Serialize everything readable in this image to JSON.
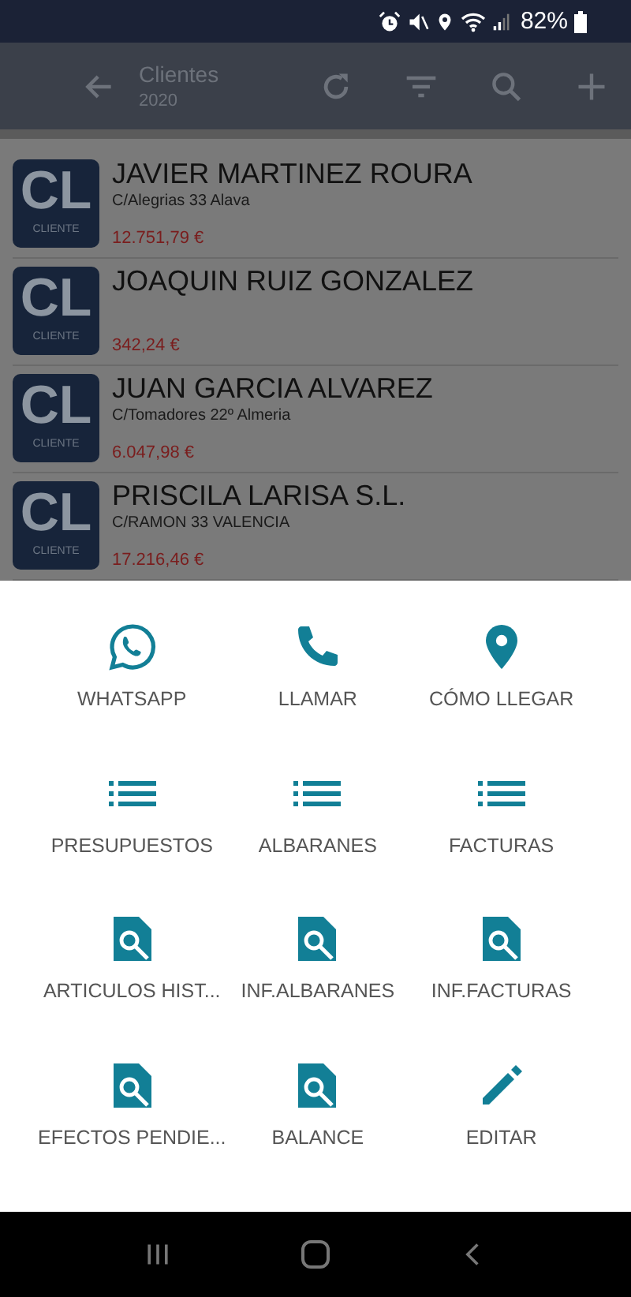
{
  "status_bar": {
    "battery": "82%"
  },
  "app_bar": {
    "title": "Clientes",
    "subtitle": "2020"
  },
  "clients": [
    {
      "name": "JAVIER MARTINEZ ROURA",
      "address": "C/Alegrias 33 Alava",
      "amount": "12.751,79 €",
      "avatar": "CL",
      "avatar_caption": "CLIENTE"
    },
    {
      "name": "JOAQUIN RUIZ GONZALEZ",
      "amount": "342,24 €",
      "avatar": "CL",
      "avatar_caption": "CLIENTE"
    },
    {
      "name": "JUAN GARCIA ALVAREZ",
      "address": "C/Tomadores 22º Almeria",
      "amount": "6.047,98 €",
      "avatar": "CL",
      "avatar_caption": "CLIENTE"
    },
    {
      "name": "PRISCILA LARISA S.L.",
      "address": "C/RAMON 33 VALENCIA",
      "amount": "17.216,46 €",
      "avatar": "CL",
      "avatar_caption": "CLIENTE"
    }
  ],
  "actions": [
    {
      "label": "WHATSAPP",
      "kind": "whatsapp"
    },
    {
      "label": "LLAMAR",
      "kind": "phone"
    },
    {
      "label": "CÓMO LLEGAR",
      "kind": "pin"
    },
    {
      "label": "PRESUPUESTOS",
      "kind": "list"
    },
    {
      "label": "ALBARANES",
      "kind": "list"
    },
    {
      "label": "FACTURAS",
      "kind": "list"
    },
    {
      "label": "ARTICULOS HIST...",
      "kind": "report"
    },
    {
      "label": "INF.ALBARANES",
      "kind": "report"
    },
    {
      "label": "INF.FACTURAS",
      "kind": "report"
    },
    {
      "label": "EFECTOS PENDIE...",
      "kind": "report"
    },
    {
      "label": "BALANCE",
      "kind": "report"
    },
    {
      "label": "EDITAR",
      "kind": "edit"
    }
  ]
}
